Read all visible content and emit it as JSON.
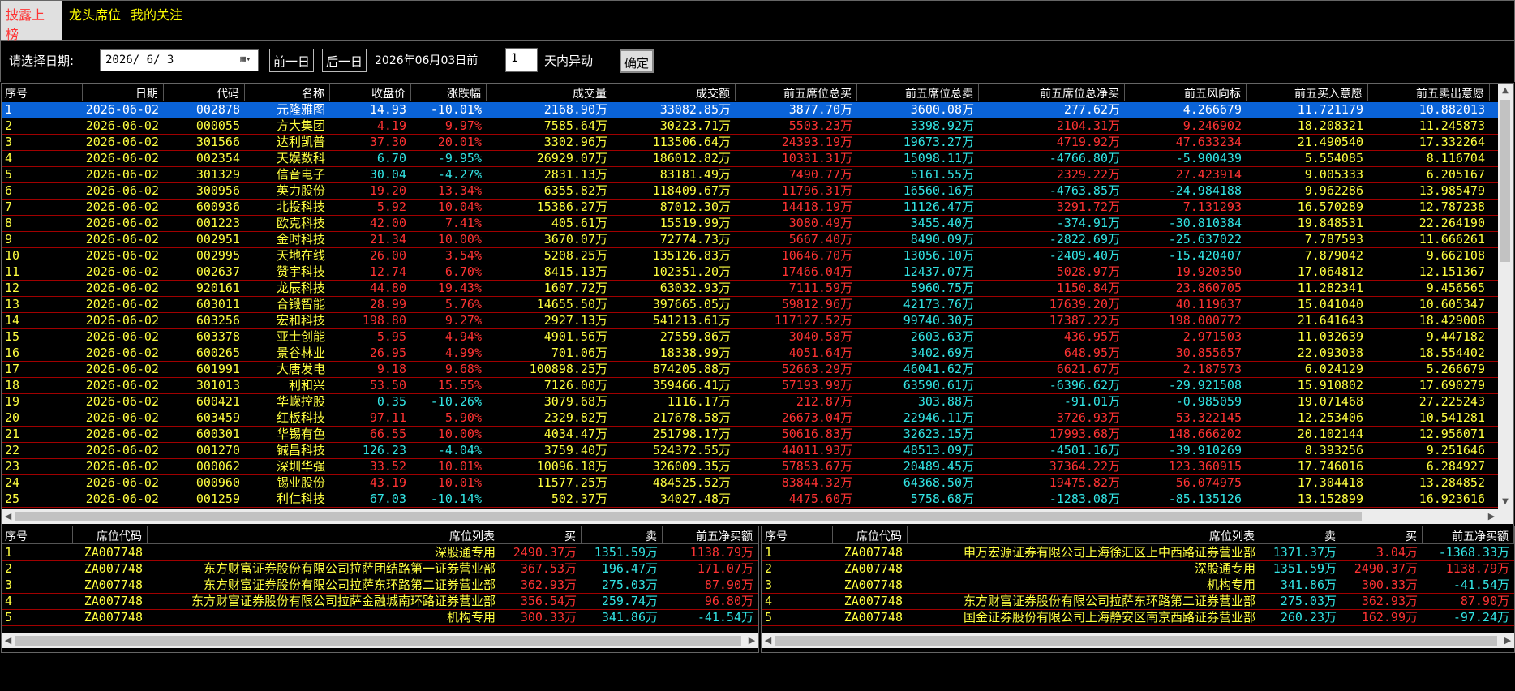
{
  "tabs": [
    {
      "label": "披露上榜",
      "active": true
    },
    {
      "label": "龙头席位",
      "active": false
    },
    {
      "label": "我的关注",
      "active": false
    }
  ],
  "toolbar": {
    "date_label": "请选择日期:",
    "date_value": "2026/ 6/ 3",
    "prev_day": "前一日",
    "next_day": "后一日",
    "date_text": "2026年06月03日前",
    "days_value": "1",
    "days_suffix": "天内异动",
    "confirm": "确定"
  },
  "colors": {
    "up": "#ff3333",
    "down": "#33e5e5",
    "text": "#ffff40",
    "select": "#0a63d8"
  },
  "main_table": {
    "headers": [
      "序号",
      "日期",
      "代码",
      "名称",
      "收盘价",
      "涨跌幅",
      "成交量",
      "成交额",
      "前五席位总买",
      "前五席位总卖",
      "前五席位总净买",
      "前五风向标",
      "前五买入意愿",
      "前五卖出意愿"
    ],
    "rows": [
      [
        "1",
        "2026-06-02",
        "002878",
        "元隆雅图",
        "14.93",
        "-10.01%",
        "2168.90万",
        "33082.85万",
        "3877.70万",
        "3600.08万",
        "277.62万",
        "4.266679",
        "11.721179",
        "10.882013"
      ],
      [
        "2",
        "2026-06-02",
        "000055",
        "方大集团",
        "4.19",
        "9.97%",
        "7585.64万",
        "30223.71万",
        "5503.23万",
        "3398.92万",
        "2104.31万",
        "9.246902",
        "18.208321",
        "11.245873"
      ],
      [
        "3",
        "2026-06-02",
        "301566",
        "达利凯普",
        "37.30",
        "20.01%",
        "3302.96万",
        "113506.64万",
        "24393.19万",
        "19673.27万",
        "4719.92万",
        "47.633234",
        "21.490540",
        "17.332264"
      ],
      [
        "4",
        "2026-06-02",
        "002354",
        "天娱数科",
        "6.70",
        "-9.95%",
        "26929.07万",
        "186012.82万",
        "10331.31万",
        "15098.11万",
        "-4766.80万",
        "-5.900439",
        "5.554085",
        "8.116704"
      ],
      [
        "5",
        "2026-06-02",
        "301329",
        "信音电子",
        "30.04",
        "-4.27%",
        "2831.13万",
        "83181.49万",
        "7490.77万",
        "5161.55万",
        "2329.22万",
        "27.423914",
        "9.005333",
        "6.205167"
      ],
      [
        "6",
        "2026-06-02",
        "300956",
        "英力股份",
        "19.20",
        "13.34%",
        "6355.82万",
        "118409.67万",
        "11796.31万",
        "16560.16万",
        "-4763.85万",
        "-24.984188",
        "9.962286",
        "13.985479"
      ],
      [
        "7",
        "2026-06-02",
        "600936",
        "北投科技",
        "5.92",
        "10.04%",
        "15386.27万",
        "87012.30万",
        "14418.19万",
        "11126.47万",
        "3291.72万",
        "7.131293",
        "16.570289",
        "12.787238"
      ],
      [
        "8",
        "2026-06-02",
        "001223",
        "欧克科技",
        "42.00",
        "7.41%",
        "405.61万",
        "15519.99万",
        "3080.49万",
        "3455.40万",
        "-374.91万",
        "-30.810384",
        "19.848531",
        "22.264190"
      ],
      [
        "9",
        "2026-06-02",
        "002951",
        "金时科技",
        "21.34",
        "10.00%",
        "3670.07万",
        "72774.73万",
        "5667.40万",
        "8490.09万",
        "-2822.69万",
        "-25.637022",
        "7.787593",
        "11.666261"
      ],
      [
        "10",
        "2026-06-02",
        "002995",
        "天地在线",
        "26.00",
        "3.54%",
        "5208.25万",
        "135126.83万",
        "10646.70万",
        "13056.10万",
        "-2409.40万",
        "-15.420407",
        "7.879042",
        "9.662108"
      ],
      [
        "11",
        "2026-06-02",
        "002637",
        "赞宇科技",
        "12.74",
        "6.70%",
        "8415.13万",
        "102351.20万",
        "17466.04万",
        "12437.07万",
        "5028.97万",
        "19.920350",
        "17.064812",
        "12.151367"
      ],
      [
        "12",
        "2026-06-02",
        "920161",
        "龙辰科技",
        "44.80",
        "19.43%",
        "1607.72万",
        "63032.93万",
        "7111.59万",
        "5960.75万",
        "1150.84万",
        "23.860705",
        "11.282341",
        "9.456565"
      ],
      [
        "13",
        "2026-06-02",
        "603011",
        "合锻智能",
        "28.99",
        "5.76%",
        "14655.50万",
        "397665.05万",
        "59812.96万",
        "42173.76万",
        "17639.20万",
        "40.119637",
        "15.041040",
        "10.605347"
      ],
      [
        "14",
        "2026-06-02",
        "603256",
        "宏和科技",
        "198.80",
        "9.27%",
        "2927.13万",
        "541213.61万",
        "117127.52万",
        "99740.30万",
        "17387.22万",
        "198.000772",
        "21.641643",
        "18.429008"
      ],
      [
        "15",
        "2026-06-02",
        "603378",
        "亚士创能",
        "5.95",
        "4.94%",
        "4901.56万",
        "27559.86万",
        "3040.58万",
        "2603.63万",
        "436.95万",
        "2.971503",
        "11.032639",
        "9.447182"
      ],
      [
        "16",
        "2026-06-02",
        "600265",
        "景谷林业",
        "26.95",
        "4.99%",
        "701.06万",
        "18338.99万",
        "4051.64万",
        "3402.69万",
        "648.95万",
        "30.855657",
        "22.093038",
        "18.554402"
      ],
      [
        "17",
        "2026-06-02",
        "601991",
        "大唐发电",
        "9.18",
        "9.68%",
        "100898.25万",
        "874205.88万",
        "52663.29万",
        "46041.62万",
        "6621.67万",
        "2.187573",
        "6.024129",
        "5.266679"
      ],
      [
        "18",
        "2026-06-02",
        "301013",
        "利和兴",
        "53.50",
        "15.55%",
        "7126.00万",
        "359466.41万",
        "57193.99万",
        "63590.61万",
        "-6396.62万",
        "-29.921508",
        "15.910802",
        "17.690279"
      ],
      [
        "19",
        "2026-06-02",
        "600421",
        "华嵘控股",
        "0.35",
        "-10.26%",
        "3079.68万",
        "1116.17万",
        "212.87万",
        "303.88万",
        "-91.01万",
        "-0.985059",
        "19.071468",
        "27.225243"
      ],
      [
        "20",
        "2026-06-02",
        "603459",
        "红板科技",
        "97.11",
        "5.90%",
        "2329.82万",
        "217678.58万",
        "26673.04万",
        "22946.11万",
        "3726.93万",
        "53.322145",
        "12.253406",
        "10.541281"
      ],
      [
        "21",
        "2026-06-02",
        "600301",
        "华锡有色",
        "66.55",
        "10.00%",
        "4034.47万",
        "251798.17万",
        "50616.83万",
        "32623.15万",
        "17993.68万",
        "148.666202",
        "20.102144",
        "12.956071"
      ],
      [
        "22",
        "2026-06-02",
        "001270",
        "铖昌科技",
        "126.23",
        "-4.04%",
        "3759.40万",
        "524372.55万",
        "44011.93万",
        "48513.09万",
        "-4501.16万",
        "-39.910269",
        "8.393256",
        "9.251646"
      ],
      [
        "23",
        "2026-06-02",
        "000062",
        "深圳华强",
        "33.52",
        "10.01%",
        "10096.18万",
        "326009.35万",
        "57853.67万",
        "20489.45万",
        "37364.22万",
        "123.360915",
        "17.746016",
        "6.284927"
      ],
      [
        "24",
        "2026-06-02",
        "000960",
        "锡业股份",
        "43.19",
        "10.01%",
        "11577.25万",
        "484525.52万",
        "83844.32万",
        "64368.50万",
        "19475.82万",
        "56.074975",
        "17.304418",
        "13.284852"
      ],
      [
        "25",
        "2026-06-02",
        "001259",
        "利仁科技",
        "67.03",
        "-10.14%",
        "502.37万",
        "34027.48万",
        "4475.60万",
        "5758.68万",
        "-1283.08万",
        "-85.135126",
        "13.152899",
        "16.923616"
      ]
    ]
  },
  "buy_panel": {
    "headers": [
      "序号",
      "席位代码",
      "席位列表",
      "买",
      "卖",
      "前五净买额"
    ],
    "rows": [
      [
        "1",
        "ZA007748",
        "深股通专用",
        "2490.37万",
        "1351.59万",
        "1138.79万"
      ],
      [
        "2",
        "ZA007748",
        "东方财富证券股份有限公司拉萨团结路第一证券营业部",
        "367.53万",
        "196.47万",
        "171.07万"
      ],
      [
        "3",
        "ZA007748",
        "东方财富证券股份有限公司拉萨东环路第二证券营业部",
        "362.93万",
        "275.03万",
        "87.90万"
      ],
      [
        "4",
        "ZA007748",
        "东方财富证券股份有限公司拉萨金融城南环路证券营业部",
        "356.54万",
        "259.74万",
        "96.80万"
      ],
      [
        "5",
        "ZA007748",
        "机构专用",
        "300.33万",
        "341.86万",
        "-41.54万"
      ]
    ]
  },
  "sell_panel": {
    "headers": [
      "序号",
      "席位代码",
      "席位列表",
      "卖",
      "买",
      "前五净买额"
    ],
    "rows": [
      [
        "1",
        "ZA007748",
        "申万宏源证券有限公司上海徐汇区上中西路证券营业部",
        "1371.37万",
        "3.04万",
        "-1368.33万"
      ],
      [
        "2",
        "ZA007748",
        "深股通专用",
        "1351.59万",
        "2490.37万",
        "1138.79万"
      ],
      [
        "3",
        "ZA007748",
        "机构专用",
        "341.86万",
        "300.33万",
        "-41.54万"
      ],
      [
        "4",
        "ZA007748",
        "东方财富证券股份有限公司拉萨东环路第二证券营业部",
        "275.03万",
        "362.93万",
        "87.90万"
      ],
      [
        "5",
        "ZA007748",
        "国金证券股份有限公司上海静安区南京西路证券营业部",
        "260.23万",
        "162.99万",
        "-97.24万"
      ]
    ]
  }
}
